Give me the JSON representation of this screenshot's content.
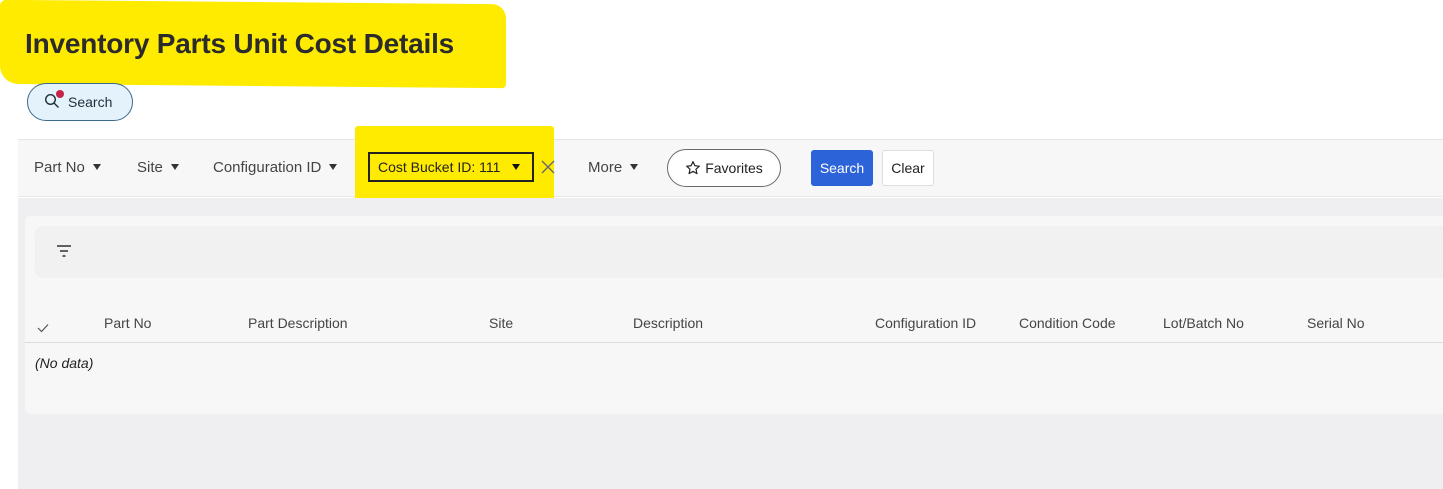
{
  "page": {
    "title": "Inventory Parts Unit Cost Details"
  },
  "search_toggle": {
    "label": "Search",
    "icon": "search-icon"
  },
  "filters": [
    {
      "label": "Part No"
    },
    {
      "label": "Site"
    },
    {
      "label": "Configuration ID"
    }
  ],
  "active_filter": {
    "label": "Cost Bucket ID: 111"
  },
  "more": {
    "label": "More"
  },
  "favorites": {
    "label": "Favorites",
    "icon": "star-icon"
  },
  "actions": {
    "search_label": "Search",
    "clear_label": "Clear"
  },
  "table": {
    "columns": [
      "Part No",
      "Part Description",
      "Site",
      "Description",
      "Configuration ID",
      "Condition Code",
      "Lot/Batch No",
      "Serial No"
    ],
    "empty_text": "(No data)"
  },
  "colors": {
    "highlight": "#ffeb00",
    "primary_button": "#2d63d8",
    "notification_dot": "#c4244a"
  }
}
